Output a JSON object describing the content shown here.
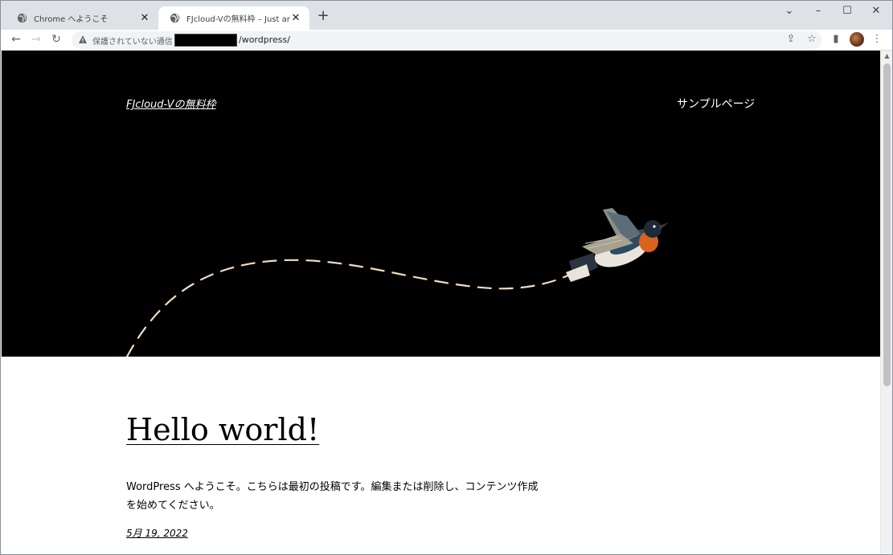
{
  "browser": {
    "tabs": [
      {
        "title": "Chrome へようこそ",
        "active": false
      },
      {
        "title": "FJcloud-Vの無料枠 – Just another",
        "active": true
      }
    ],
    "new_tab_label": "+",
    "address": {
      "security_label": "保護されていない通信",
      "url_path": "/wordpress/"
    },
    "window_controls": {
      "dropdown": "⌄",
      "minimize": "–",
      "maximize": "☐",
      "close": "✕"
    }
  },
  "site": {
    "title": "FJcloud-Vの無料枠",
    "nav": [
      "サンプルページ"
    ]
  },
  "post": {
    "title": "Hello world!",
    "body": "WordPress へようこそ。こちらは最初の投稿です。編集または削除し、コンテンツ作成を始めてください。",
    "date": "5月 19, 2022"
  },
  "colors": {
    "hero_bg": "#000000",
    "dash_line": "#f2dcc0",
    "tabstrip": "#dee1e6"
  }
}
